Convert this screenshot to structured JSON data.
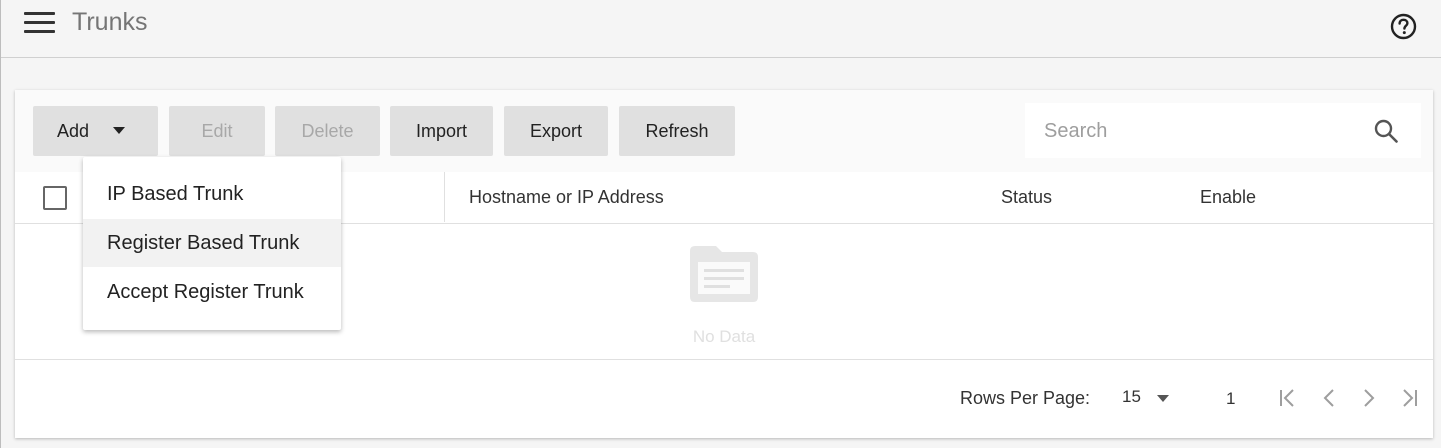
{
  "header": {
    "title": "Trunks",
    "menu_icon": "hamburger-menu-icon",
    "help_icon": "help-circle-icon"
  },
  "toolbar": {
    "add_label": "Add",
    "edit_label": "Edit",
    "delete_label": "Delete",
    "import_label": "Import",
    "export_label": "Export",
    "refresh_label": "Refresh"
  },
  "search": {
    "placeholder": "Search",
    "value": "",
    "icon": "search-icon"
  },
  "add_menu": {
    "items": [
      {
        "label": "IP Based Trunk"
      },
      {
        "label": "Register Based Trunk",
        "highlighted": true
      },
      {
        "label": "Accept Register Trunk"
      }
    ]
  },
  "table": {
    "columns": [
      "Hostname or IP Address",
      "Status",
      "Enable"
    ],
    "rows": [],
    "empty_text": "No Data",
    "empty_icon": "empty-document-icon"
  },
  "pagination": {
    "rows_per_page_label": "Rows Per Page:",
    "rows_per_page_value": "15",
    "current_page": "1"
  },
  "colors": {
    "background": "#f5f5f5",
    "button": "#e0e0e0",
    "disabled_text": "#a8a8a8",
    "highlight": "#f2f2f2"
  }
}
